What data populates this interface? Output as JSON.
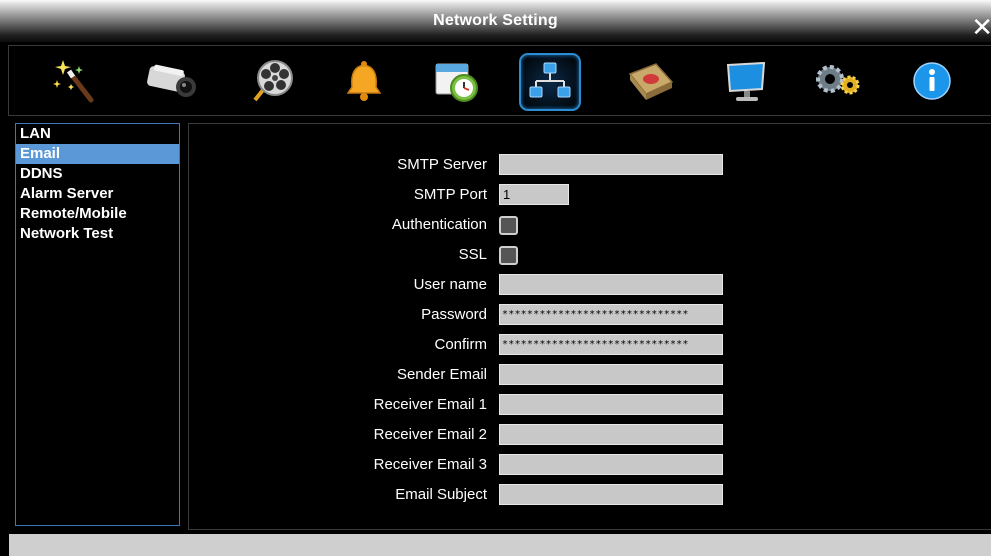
{
  "window": {
    "title": "Network Setting",
    "close_glyph": "✕"
  },
  "toolbar": {
    "icons": [
      {
        "name": "wizard-wand-icon"
      },
      {
        "name": "camera-icon"
      },
      {
        "name": "film-reel-icon"
      },
      {
        "name": "alarm-bell-icon"
      },
      {
        "name": "schedule-clock-icon"
      },
      {
        "name": "network-icon",
        "selected": true
      },
      {
        "name": "hard-disk-icon"
      },
      {
        "name": "monitor-icon"
      },
      {
        "name": "system-gears-icon"
      },
      {
        "name": "info-icon"
      }
    ]
  },
  "sidebar": {
    "items": [
      {
        "label": "LAN",
        "selected": false
      },
      {
        "label": "Email",
        "selected": true
      },
      {
        "label": "DDNS",
        "selected": false
      },
      {
        "label": "Alarm Server",
        "selected": false
      },
      {
        "label": "Remote/Mobile",
        "selected": false
      },
      {
        "label": "Network Test",
        "selected": false
      }
    ]
  },
  "form": {
    "smtp_server": {
      "label": "SMTP Server",
      "value": ""
    },
    "smtp_port": {
      "label": "SMTP Port",
      "value": "1"
    },
    "authentication": {
      "label": "Authentication",
      "checked": false
    },
    "ssl": {
      "label": "SSL",
      "checked": false
    },
    "user_name": {
      "label": "User name",
      "value": ""
    },
    "password": {
      "label": "Password",
      "value": "******************************"
    },
    "confirm": {
      "label": "Confirm",
      "value": "******************************"
    },
    "sender_email": {
      "label": "Sender Email",
      "value": ""
    },
    "receiver_email_1": {
      "label": "Receiver Email 1",
      "value": ""
    },
    "receiver_email_2": {
      "label": "Receiver Email 2",
      "value": ""
    },
    "receiver_email_3": {
      "label": "Receiver Email 3",
      "value": ""
    },
    "email_subject": {
      "label": "Email Subject",
      "value": ""
    }
  },
  "colors": {
    "selection": "#5b98d7",
    "field_bg": "#c8c8c8",
    "background": "#000000"
  }
}
